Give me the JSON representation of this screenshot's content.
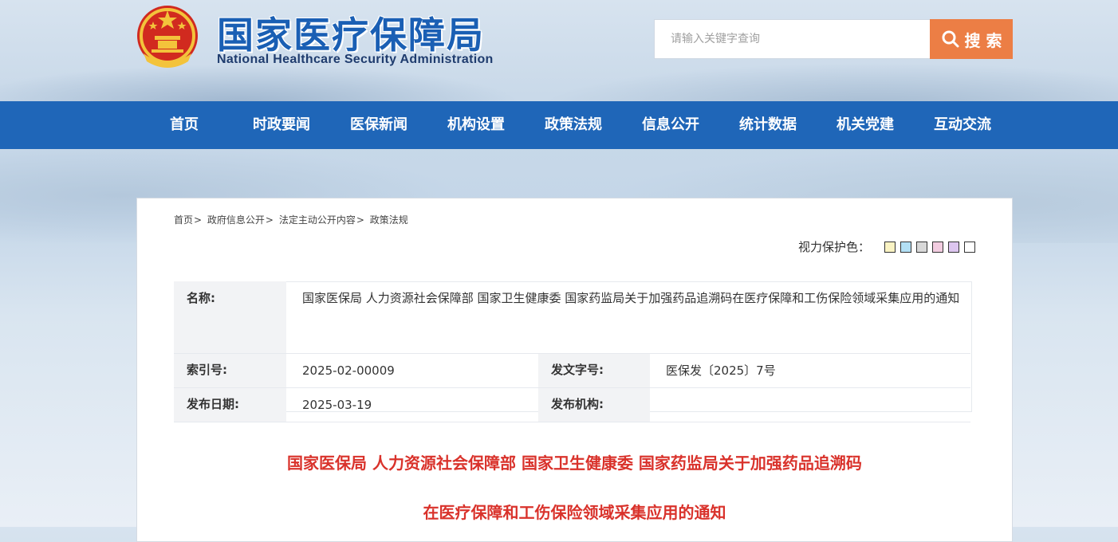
{
  "header": {
    "title_cn": "国家医疗保障局",
    "title_en": "National Healthcare Security Administration",
    "search_placeholder": "请输入关键字查询",
    "search_button": "搜 索"
  },
  "nav": [
    {
      "label": "首页"
    },
    {
      "label": "时政要闻"
    },
    {
      "label": "医保新闻"
    },
    {
      "label": "机构设置"
    },
    {
      "label": "政策法规"
    },
    {
      "label": "信息公开"
    },
    {
      "label": "统计数据"
    },
    {
      "label": "机关党建"
    },
    {
      "label": "互动交流"
    }
  ],
  "breadcrumb": [
    {
      "label": "首页"
    },
    {
      "label": "政府信息公开"
    },
    {
      "label": "法定主动公开内容"
    },
    {
      "label": "政策法规"
    }
  ],
  "eye_protection": {
    "label": "视力保护色：",
    "colors": [
      "#faf3c3",
      "#b3e0f5",
      "#d8d8d8",
      "#f2cce0",
      "#ddc6f0",
      "#ffffff"
    ]
  },
  "meta": {
    "name_label": "名称:",
    "name_value": "国家医保局 人力资源社会保障部 国家卫生健康委 国家药监局关于加强药品追溯码在医疗保障和工伤保险领域采集应用的通知",
    "index_label": "索引号:",
    "index_value": "2025-02-00009",
    "docno_label": "发文字号:",
    "docno_value": "医保发〔2025〕7号",
    "date_label": "发布日期:",
    "date_value": "2025-03-19",
    "org_label": "发布机构:",
    "org_value": ""
  },
  "document": {
    "title_line1": "国家医保局 人力资源社会保障部 国家卫生健康委 国家药监局关于加强药品追溯码",
    "title_line2": "在医疗保障和工伤保险领域采集应用的通知"
  }
}
